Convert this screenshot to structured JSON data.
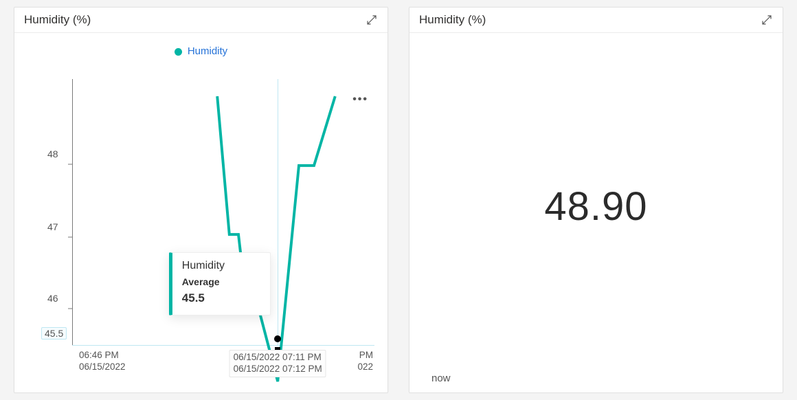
{
  "left_card": {
    "title": "Humidity (%)",
    "legend": {
      "series_name": "Humidity",
      "color": "#00b5a5"
    },
    "tooltip": {
      "title": "Humidity",
      "metric_label": "Average",
      "value": "45.5"
    },
    "x_start_label_line1": "06:46 PM",
    "x_start_label_line2": "06/15/2022",
    "x_hover_label_line1": "06/15/2022 07:11 PM",
    "x_hover_label_line2": "06/15/2022 07:12 PM",
    "x_end_frag_line1": "PM",
    "x_end_frag_line2": "022",
    "y_marker_value": "45.5",
    "y_ticks": [
      "46",
      "47",
      "48"
    ]
  },
  "right_card": {
    "title": "Humidity (%)",
    "value": "48.90",
    "time_label": "now"
  },
  "chart_data": {
    "type": "line",
    "title": "Humidity (%)",
    "ylabel": "Humidity (%)",
    "ylim": [
      45.5,
      49
    ],
    "x_labels_shown": [
      "06/15/2022 06:46 PM",
      "06/15/2022 07:11 PM",
      "06/15/2022 07:12 PM"
    ],
    "series": [
      {
        "name": "Humidity",
        "color": "#00b5a5",
        "points": [
          {
            "x": "06/15/2022 07:01 PM",
            "y": 48.8
          },
          {
            "x": "06/15/2022 07:03 PM",
            "y": 47.2
          },
          {
            "x": "06/15/2022 07:04 PM",
            "y": 47.2
          },
          {
            "x": "06/15/2022 07:05 PM",
            "y": 46.3
          },
          {
            "x": "06/15/2022 07:07 PM",
            "y": 46.3
          },
          {
            "x": "06/15/2022 07:11 PM",
            "y": 45.5
          },
          {
            "x": "06/15/2022 07:13 PM",
            "y": 48.0
          },
          {
            "x": "06/15/2022 07:15 PM",
            "y": 48.0
          },
          {
            "x": "06/15/2022 07:17 PM",
            "y": 48.8
          }
        ]
      }
    ],
    "hover_point": {
      "x": "06/15/2022 07:11 PM",
      "y": 45.5,
      "metric": "Average"
    }
  }
}
